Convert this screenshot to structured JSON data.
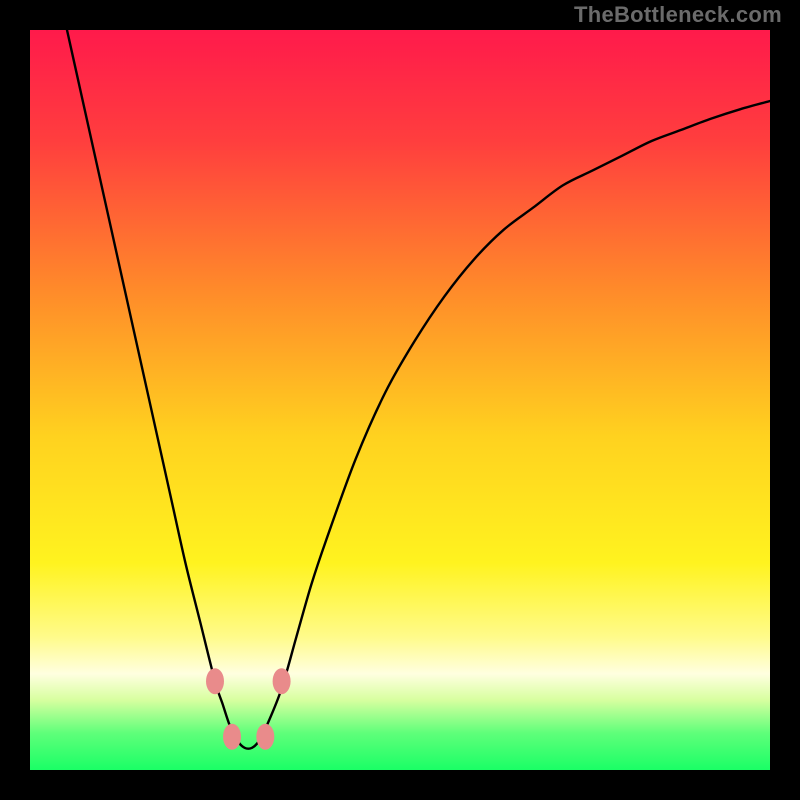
{
  "watermark": {
    "text": "TheBottleneck.com"
  },
  "chart_data": {
    "type": "line",
    "title": "",
    "xlabel": "",
    "ylabel": "",
    "xlim": [
      0,
      100
    ],
    "ylim": [
      0,
      100
    ],
    "grid": false,
    "legend": false,
    "background_gradient": {
      "stops": [
        {
          "pos": 0.0,
          "color": "#ff1a4b"
        },
        {
          "pos": 0.15,
          "color": "#ff3e3e"
        },
        {
          "pos": 0.35,
          "color": "#ff8a2a"
        },
        {
          "pos": 0.55,
          "color": "#ffd21f"
        },
        {
          "pos": 0.72,
          "color": "#fff31f"
        },
        {
          "pos": 0.82,
          "color": "#fffb8a"
        },
        {
          "pos": 0.87,
          "color": "#ffffe0"
        },
        {
          "pos": 0.905,
          "color": "#d8ffa0"
        },
        {
          "pos": 0.95,
          "color": "#5fff7a"
        },
        {
          "pos": 1.0,
          "color": "#1aff66"
        }
      ]
    },
    "series": [
      {
        "name": "bottleneck-curve",
        "color": "#000000",
        "x": [
          5,
          7,
          9,
          11,
          13,
          15,
          17,
          19,
          21,
          23,
          25,
          26,
          27,
          28,
          29,
          30,
          31,
          32,
          34,
          36,
          38,
          40,
          44,
          48,
          52,
          56,
          60,
          64,
          68,
          72,
          76,
          80,
          84,
          88,
          92,
          96,
          100
        ],
        "y": [
          100,
          91,
          82,
          73,
          64,
          55,
          46,
          37,
          28,
          20,
          12,
          9,
          6,
          4,
          3,
          3,
          4,
          6,
          11,
          18,
          25,
          31,
          42,
          51,
          58,
          64,
          69,
          73,
          76,
          79,
          81,
          83,
          85,
          86.5,
          88,
          89.3,
          90.4
        ]
      }
    ],
    "markers": [
      {
        "name": "marker-left-upper",
        "x": 25.0,
        "y": 12.0,
        "color": "#e98b8b"
      },
      {
        "name": "marker-left-lower",
        "x": 27.3,
        "y": 4.5,
        "color": "#e98b8b"
      },
      {
        "name": "marker-right-lower",
        "x": 31.8,
        "y": 4.5,
        "color": "#e98b8b"
      },
      {
        "name": "marker-right-upper",
        "x": 34.0,
        "y": 12.0,
        "color": "#e98b8b"
      }
    ]
  }
}
